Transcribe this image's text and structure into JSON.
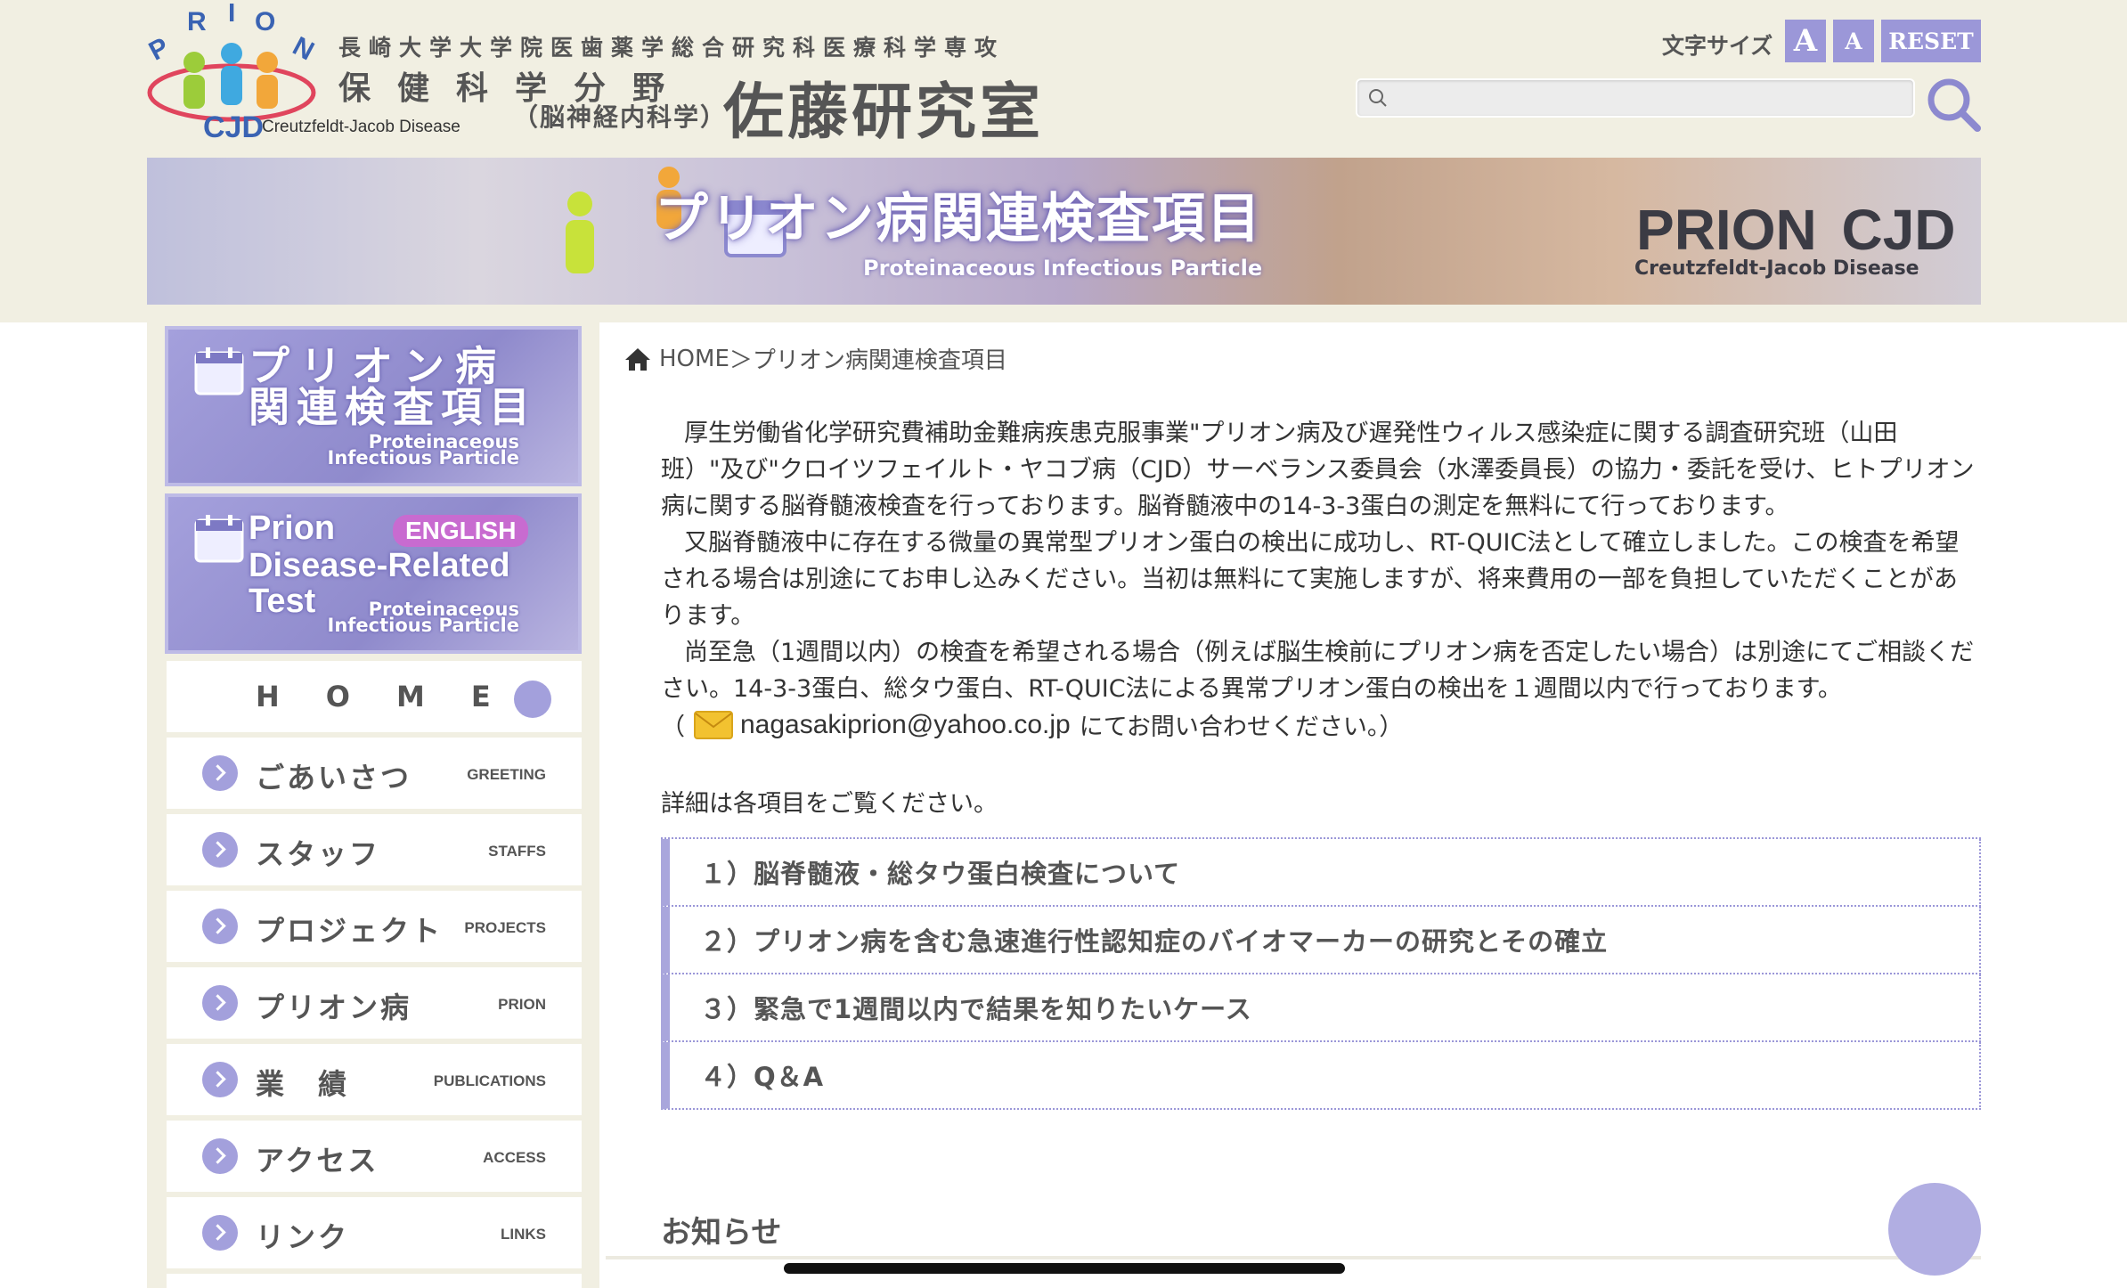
{
  "header": {
    "logo_text_top": "PRION",
    "logo_text_cjd": "CJD",
    "logo_subtitle": "Creutzfeldt-Jacob Disease",
    "lab_line1": "長崎大学大学院医歯薬学総合研究科医療科学専攻",
    "lab_line2": "保健科学分野",
    "lab_line3": "（脳神経内科学）",
    "lab_name": "佐藤研究室",
    "font_size_label": "文字サイズ",
    "font_large": "A",
    "font_small": "A",
    "font_reset": "RESET",
    "search_placeholder": ""
  },
  "banner": {
    "title": "プリオン病関連検査項目",
    "subtitle": "Proteinaceous Infectious Particle",
    "brand_prion": "PRION",
    "brand_cjd": "CJD",
    "brand_sub": "Creutzfeldt-Jacob Disease"
  },
  "sidebar": {
    "banner1": {
      "title_line1": "プリオン病",
      "title_line2": "関連検査項目",
      "en_line1": "Proteinaceous",
      "en_line2": "Infectious Particle"
    },
    "banner2": {
      "line1": "Prion",
      "badge": "ENGLISH",
      "line2": "Disease-Related",
      "line3": "Test",
      "en_line1": "Proteinaceous",
      "en_line2": "Infectious Particle"
    },
    "home_label": "HOME",
    "menu": [
      {
        "jp": "ごあいさつ",
        "en": "GREETING"
      },
      {
        "jp": "スタッフ",
        "en": "STAFFS"
      },
      {
        "jp": "プロジェクト",
        "en": "PROJECTS"
      },
      {
        "jp": "プリオン病",
        "en": "PRION"
      },
      {
        "jp": "業　績",
        "en": "PUBLICATIONS"
      },
      {
        "jp": "アクセス",
        "en": "ACCESS"
      },
      {
        "jp": "リンク",
        "en": "LINKS"
      }
    ]
  },
  "breadcrumb": {
    "home": "HOME",
    "separator": "＞",
    "current": "プリオン病関連検査項目"
  },
  "intro": {
    "p1": "厚生労働省化学研究費補助金難病疾患克服事業\"プリオン病及び遅発性ウィルス感染症に関する調査研究班（山田班）\"及び\"クロイツフェイルト・ヤコブ病（CJD）サーベランス委員会（水澤委員長）の協力・委託を受け、ヒトプリオン病に関する脳脊髄液検査を行っております。脳脊髄液中の14-3-3蛋白の測定を無料にて行っております。",
    "p2": "又脳脊髄液中に存在する微量の異常型プリオン蛋白の検出に成功し、RT-QUIC法として確立しました。この検査を希望される場合は別途にてお申し込みください。当初は無料にて実施しますが、将来費用の一部を負担していただくことがあります。",
    "p3": "尚至急（1週間以内）の検査を希望される場合（例えば脳生検前にプリオン病を否定したい場合）は別途にてご相談ください。14-3-3蛋白、総タウ蛋白、RT-QUIC法による異常プリオン蛋白の検出を１週間以内で行っております。",
    "contact_open": "（",
    "email": "nagasakiprion@yahoo.co.jp",
    "contact_close": "にてお問い合わせください。）",
    "detail": "詳細は各項目をご覧ください。"
  },
  "items": [
    "１）脳脊髄液・総タウ蛋白検査について",
    "２）プリオン病を含む急速進行性認知症のバイオマーカーの研究とその確立",
    "３）緊急で1週間以内で結果を知りたいケース",
    "４）Q＆A"
  ],
  "news": {
    "title": "お知らせ"
  },
  "colors": {
    "accent": "#a3a0dc",
    "header_bg": "#f1efe2"
  }
}
